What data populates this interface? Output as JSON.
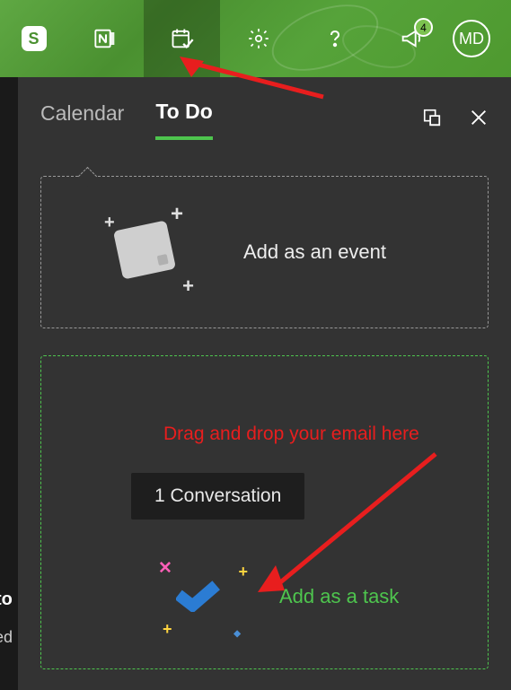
{
  "topbar": {
    "skype_letter": "S",
    "notification_count": "4",
    "avatar_initials": "MD"
  },
  "panel": {
    "tabs": {
      "calendar": "Calendar",
      "todo": "To Do"
    },
    "event_zone_label": "Add as an event",
    "task_zone_label": "Add as a task",
    "conversation_chip": "1 Conversation"
  },
  "annotations": {
    "drag_hint": "Drag and drop your email here"
  },
  "left_edge": {
    "frag1": "to",
    "frag2": "ed"
  }
}
